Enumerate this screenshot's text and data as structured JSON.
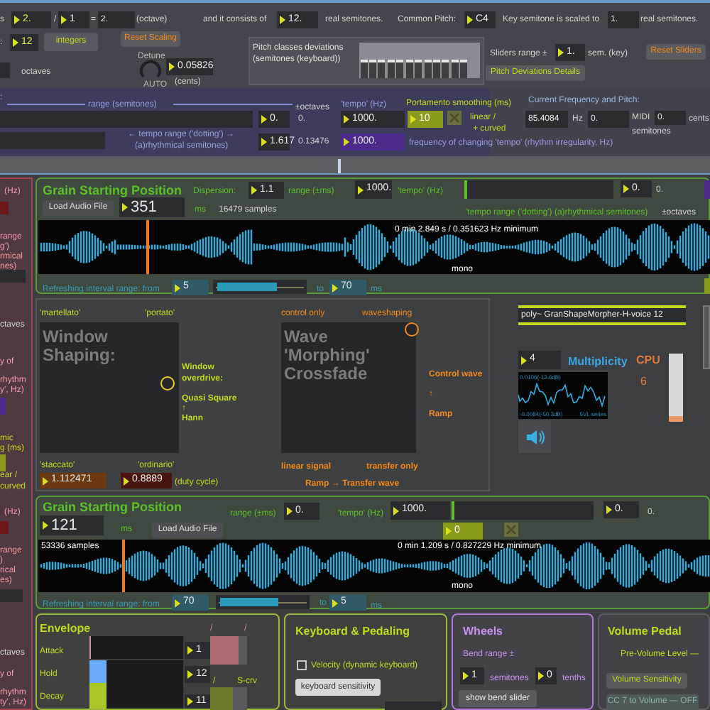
{
  "scale_row": {
    "items": [
      {
        "kind": "label",
        "text": "s"
      },
      {
        "kind": "number",
        "text": "2."
      },
      {
        "kind": "label",
        "text": "/"
      },
      {
        "kind": "number",
        "text": "1"
      },
      {
        "kind": "label",
        "text": "="
      },
      {
        "kind": "field",
        "text": "2."
      },
      {
        "kind": "label",
        "text": "(octave)"
      },
      {
        "kind": "label",
        "text": "and it consists of"
      },
      {
        "kind": "number",
        "text": "12."
      },
      {
        "kind": "label",
        "text": "real semitones."
      },
      {
        "kind": "label",
        "text": "Common Pitch:"
      },
      {
        "kind": "number",
        "text": "C4"
      },
      {
        "kind": "label",
        "text": "Key semitone is scaled to"
      },
      {
        "kind": "field",
        "text": "1."
      },
      {
        "kind": "label",
        "text": "real semitones."
      },
      {
        "kind": "label",
        "text": ":"
      },
      {
        "kind": "number",
        "text": "12"
      },
      {
        "kind": "button",
        "text": "integers"
      },
      {
        "kind": "button",
        "text": "Reset Scaling"
      },
      {
        "kind": "label",
        "text": "octaves"
      },
      {
        "kind": "label",
        "text": "Detune"
      },
      {
        "kind": "dial"
      },
      {
        "kind": "label",
        "text": "AUTO"
      },
      {
        "kind": "number",
        "text": "0.05826"
      },
      {
        "kind": "label",
        "text": "(cents)"
      }
    ]
  },
  "pitch_deviations": {
    "items": [
      {
        "kind": "label",
        "text": "Pitch classes deviations"
      },
      {
        "kind": "label",
        "text": "(semitones (keyboard))"
      },
      {
        "kind": "sliders"
      },
      {
        "kind": "label",
        "text": "Sliders range ±"
      },
      {
        "kind": "number",
        "text": "1."
      },
      {
        "kind": "label",
        "text": "sem. (key)"
      },
      {
        "kind": "button",
        "text": "Reset Sliders"
      },
      {
        "kind": "button",
        "text": "Pitch Deviations Details"
      }
    ]
  },
  "tempo_panel": {
    "items": [
      {
        "kind": "label",
        "text": ":"
      },
      {
        "kind": "label",
        "text": "range (semitones)"
      },
      {
        "kind": "label",
        "text": "±octaves"
      },
      {
        "kind": "label",
        "text": "'tempo' (Hz)"
      },
      {
        "kind": "number",
        "text": "0."
      },
      {
        "kind": "label",
        "text": "0."
      },
      {
        "kind": "number",
        "text": "1000."
      },
      {
        "kind": "label",
        "text": "← tempo range ('dotting') →"
      },
      {
        "kind": "label",
        "text": "(a)rhythmical semitones)"
      },
      {
        "kind": "number",
        "text": "1.617"
      },
      {
        "kind": "label",
        "text": "0.13476"
      },
      {
        "kind": "number",
        "text": "1000."
      },
      {
        "kind": "label",
        "text": "Portamento smoothing (ms)"
      },
      {
        "kind": "number",
        "text": "10"
      },
      {
        "kind": "toggle",
        "on": false
      },
      {
        "kind": "label",
        "text": "linear /"
      },
      {
        "kind": "label",
        "text": "+ curved"
      },
      {
        "kind": "label",
        "text": "frequency of changing 'tempo' (rhythm irregularity, Hz)"
      },
      {
        "kind": "label",
        "text": "Current Frequency and Pitch:"
      },
      {
        "kind": "field",
        "text": "85.4084"
      },
      {
        "kind": "label",
        "text": "Hz"
      },
      {
        "kind": "field",
        "text": "0."
      },
      {
        "kind": "label",
        "text": "MIDI"
      },
      {
        "kind": "label",
        "text": "semitones"
      },
      {
        "kind": "field",
        "text": "0."
      },
      {
        "kind": "label",
        "text": "cents"
      }
    ]
  },
  "left_strip": {
    "items": [
      {
        "kind": "label",
        "text": "(Hz)"
      },
      {
        "kind": "label",
        "text": "range"
      },
      {
        "kind": "label",
        "text": "g')"
      },
      {
        "kind": "label",
        "text": "rmical"
      },
      {
        "kind": "label",
        "text": "nes)"
      },
      {
        "kind": "label",
        "text": "ctaves"
      },
      {
        "kind": "label",
        "text": "y of"
      },
      {
        "kind": "label",
        "text": "rhythm"
      },
      {
        "kind": "label",
        "text": "y', Hz)"
      },
      {
        "kind": "label",
        "text": "mic"
      },
      {
        "kind": "label",
        "text": "g (ms)"
      },
      {
        "kind": "label",
        "text": "ear /"
      },
      {
        "kind": "label",
        "text": "curved"
      },
      {
        "kind": "label",
        "text": "(Hz)"
      },
      {
        "kind": "label",
        "text": "range"
      },
      {
        "kind": "label",
        "text": ")"
      },
      {
        "kind": "label",
        "text": "rical"
      },
      {
        "kind": "label",
        "text": "es)"
      },
      {
        "kind": "label",
        "text": "ctaves"
      },
      {
        "kind": "label",
        "text": "y of"
      },
      {
        "kind": "label",
        "text": "rhythm"
      },
      {
        "kind": "label",
        "text": "ty', Hz)"
      }
    ]
  },
  "grain_1": {
    "items": [
      {
        "kind": "title",
        "text": "Grain Starting Position"
      },
      {
        "kind": "label",
        "text": "Dispersion:"
      },
      {
        "kind": "number",
        "text": "1.1"
      },
      {
        "kind": "label",
        "text": "range (±ms)"
      },
      {
        "kind": "number",
        "text": "1000."
      },
      {
        "kind": "label",
        "text": "'tempo' (Hz)"
      },
      {
        "kind": "number",
        "text": "0."
      },
      {
        "kind": "label",
        "text": "0."
      },
      {
        "kind": "button",
        "text": "Load Audio File"
      },
      {
        "kind": "number",
        "text": "351"
      },
      {
        "kind": "label",
        "text": "ms"
      },
      {
        "kind": "label",
        "text": "16479 samples"
      },
      {
        "kind": "label",
        "text": "'tempo range ('dotting') (a)rhythmical semitones)"
      },
      {
        "kind": "label",
        "text": "±octaves"
      },
      {
        "kind": "wave",
        "level": 0.16
      },
      {
        "kind": "label",
        "text": "0 min 2.849 s  /  0.351623 Hz minimum"
      },
      {
        "kind": "label",
        "text": "mono"
      },
      {
        "kind": "label",
        "text": "Refreshing interval range:  from"
      },
      {
        "kind": "number",
        "text": "5"
      },
      {
        "kind": "slider",
        "level": 0.7
      },
      {
        "kind": "label",
        "text": "to"
      },
      {
        "kind": "number",
        "text": "70"
      },
      {
        "kind": "label",
        "text": "ms"
      }
    ]
  },
  "window_shaping": {
    "items": [
      {
        "kind": "label",
        "text": "'martellato'"
      },
      {
        "kind": "label",
        "text": "'portato'"
      },
      {
        "kind": "pad",
        "text": "Window Shaping:"
      },
      {
        "kind": "label",
        "text": "Window overdrive:"
      },
      {
        "kind": "label",
        "text": "Quasi Square"
      },
      {
        "kind": "label",
        "text": "↑"
      },
      {
        "kind": "label",
        "text": "Hann"
      },
      {
        "kind": "label",
        "text": "'staccato'"
      },
      {
        "kind": "label",
        "text": "'ordinario'"
      },
      {
        "kind": "number",
        "text": "1.112471"
      },
      {
        "kind": "number",
        "text": "0.8889"
      },
      {
        "kind": "label",
        "text": "(duty cycle)"
      }
    ]
  },
  "wave_morphing": {
    "items": [
      {
        "kind": "label",
        "text": "control only"
      },
      {
        "kind": "label",
        "text": "waveshaping"
      },
      {
        "kind": "pad",
        "text": "Wave 'Morphing' Crossfade"
      },
      {
        "kind": "label",
        "text": "Control wave"
      },
      {
        "kind": "label",
        "text": "↑"
      },
      {
        "kind": "label",
        "text": "Ramp"
      },
      {
        "kind": "label",
        "text": "linear signal"
      },
      {
        "kind": "label",
        "text": "transfer only"
      },
      {
        "kind": "label",
        "text": "Ramp → Transfer wave"
      }
    ]
  },
  "poly_panel": {
    "items": [
      {
        "kind": "field",
        "text": "poly~ GranShapeMorpher-H-voice 12"
      },
      {
        "kind": "number",
        "text": "4"
      },
      {
        "kind": "label",
        "text": "Multiplicity"
      },
      {
        "kind": "label",
        "text": "CPU"
      },
      {
        "kind": "label",
        "text": "6"
      },
      {
        "kind": "meter",
        "level": 0.08
      },
      {
        "kind": "scope",
        "top_label": "0.0106(-12.6dB)",
        "bottom_label": "-0.0084(-50.3dB)",
        "series_label": "5VL series"
      },
      {
        "kind": "speaker"
      }
    ]
  },
  "grain_2": {
    "items": [
      {
        "kind": "title",
        "text": "Grain Starting Position"
      },
      {
        "kind": "label",
        "text": "range (±ms)"
      },
      {
        "kind": "number",
        "text": "0."
      },
      {
        "kind": "label",
        "text": "'tempo' (Hz)"
      },
      {
        "kind": "number",
        "text": "1000."
      },
      {
        "kind": "number",
        "text": "0."
      },
      {
        "kind": "label",
        "text": "0."
      },
      {
        "kind": "number",
        "text": "121"
      },
      {
        "kind": "label",
        "text": "ms"
      },
      {
        "kind": "button",
        "text": "Load Audio File"
      },
      {
        "kind": "number",
        "text": "0"
      },
      {
        "kind": "toggle",
        "on": false
      },
      {
        "kind": "wave",
        "level": 0.125
      },
      {
        "kind": "label",
        "text": "53336 samples"
      },
      {
        "kind": "label",
        "text": "0 min 1.209 s  /  0.827229 Hz minimum"
      },
      {
        "kind": "label",
        "text": "mono"
      },
      {
        "kind": "label",
        "text": "Refreshing interval range:  from"
      },
      {
        "kind": "number",
        "text": "70"
      },
      {
        "kind": "slider",
        "level": 0.68
      },
      {
        "kind": "label",
        "text": "to"
      },
      {
        "kind": "number",
        "text": "5"
      },
      {
        "kind": "label",
        "text": "ms"
      }
    ]
  },
  "envelope": {
    "items": [
      {
        "kind": "title",
        "text": "Envelope"
      },
      {
        "kind": "label",
        "text": "Attack"
      },
      {
        "kind": "label",
        "text": "Hold"
      },
      {
        "kind": "label",
        "text": "Decay"
      },
      {
        "kind": "bar",
        "level": 0.02
      },
      {
        "kind": "bar",
        "level": 0.18
      },
      {
        "kind": "bar",
        "level": 0.18
      },
      {
        "kind": "number",
        "text": "1"
      },
      {
        "kind": "number",
        "text": "12"
      },
      {
        "kind": "number",
        "text": "11"
      },
      {
        "kind": "label",
        "text": "/"
      },
      {
        "kind": "label",
        "text": "/"
      },
      {
        "kind": "slider",
        "level": 0.75
      },
      {
        "kind": "label",
        "text": "/"
      },
      {
        "kind": "label",
        "text": "S-crv"
      },
      {
        "kind": "slider",
        "level": 0.6
      }
    ]
  },
  "keyboard_pedaling": {
    "items": [
      {
        "kind": "title",
        "text": "Keyboard & Pedaling"
      },
      {
        "kind": "checkbox",
        "text": "Velocity (dynamic keyboard)",
        "checked": false
      },
      {
        "kind": "button",
        "text": "keyboard sensitivity"
      }
    ]
  },
  "wheels": {
    "items": [
      {
        "kind": "title",
        "text": "Wheels"
      },
      {
        "kind": "label",
        "text": "Bend range ±"
      },
      {
        "kind": "number",
        "text": "1"
      },
      {
        "kind": "label",
        "text": "semitones"
      },
      {
        "kind": "number",
        "text": "0"
      },
      {
        "kind": "label",
        "text": "tenths"
      },
      {
        "kind": "button",
        "text": "show bend slider"
      }
    ]
  },
  "volume_pedal": {
    "items": [
      {
        "kind": "title",
        "text": "Volume Pedal"
      },
      {
        "kind": "label",
        "text": "Pre-Volume Level —"
      },
      {
        "kind": "button",
        "text": "Volume Sensitivity"
      },
      {
        "kind": "button",
        "text": "CC 7 to Volume — OFF"
      }
    ]
  }
}
